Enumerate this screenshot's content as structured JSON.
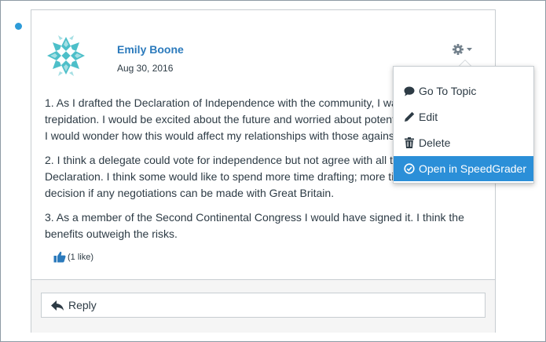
{
  "entry": {
    "author": "Emily Boone",
    "date": "Aug 30, 2016",
    "paragraphs": [
      "1. As I drafted the Declaration of Independence with the community, I was filled with trepidation. I would be excited about the future and worried about potential consequences. I would wonder how this would affect my relationships with those against independence.",
      "2. I think a delegate could vote for independence but not agree with all the words in the Declaration. I think some would like to spend more time drafting; more time to make a decision if any negotiations can be made with Great Britain.",
      "3. As a member of the Second Continental Congress I would have signed it. I think the benefits outweigh the risks."
    ],
    "like_text": "(1 like)"
  },
  "reply": {
    "label": "Reply"
  },
  "menu": {
    "items": [
      {
        "label": "Go To Topic",
        "icon": "speech-bubble-icon"
      },
      {
        "label": "Edit",
        "icon": "pencil-icon"
      },
      {
        "label": "Delete",
        "icon": "trash-icon"
      },
      {
        "label": "Open in SpeedGrader",
        "icon": "speedgrader-icon",
        "active": true
      }
    ]
  },
  "colors": {
    "accent": "#2b8fd8",
    "author_link": "#2b7abc",
    "unread_dot": "#2d9bd8",
    "avatar_teal": "#4dbfc9"
  }
}
